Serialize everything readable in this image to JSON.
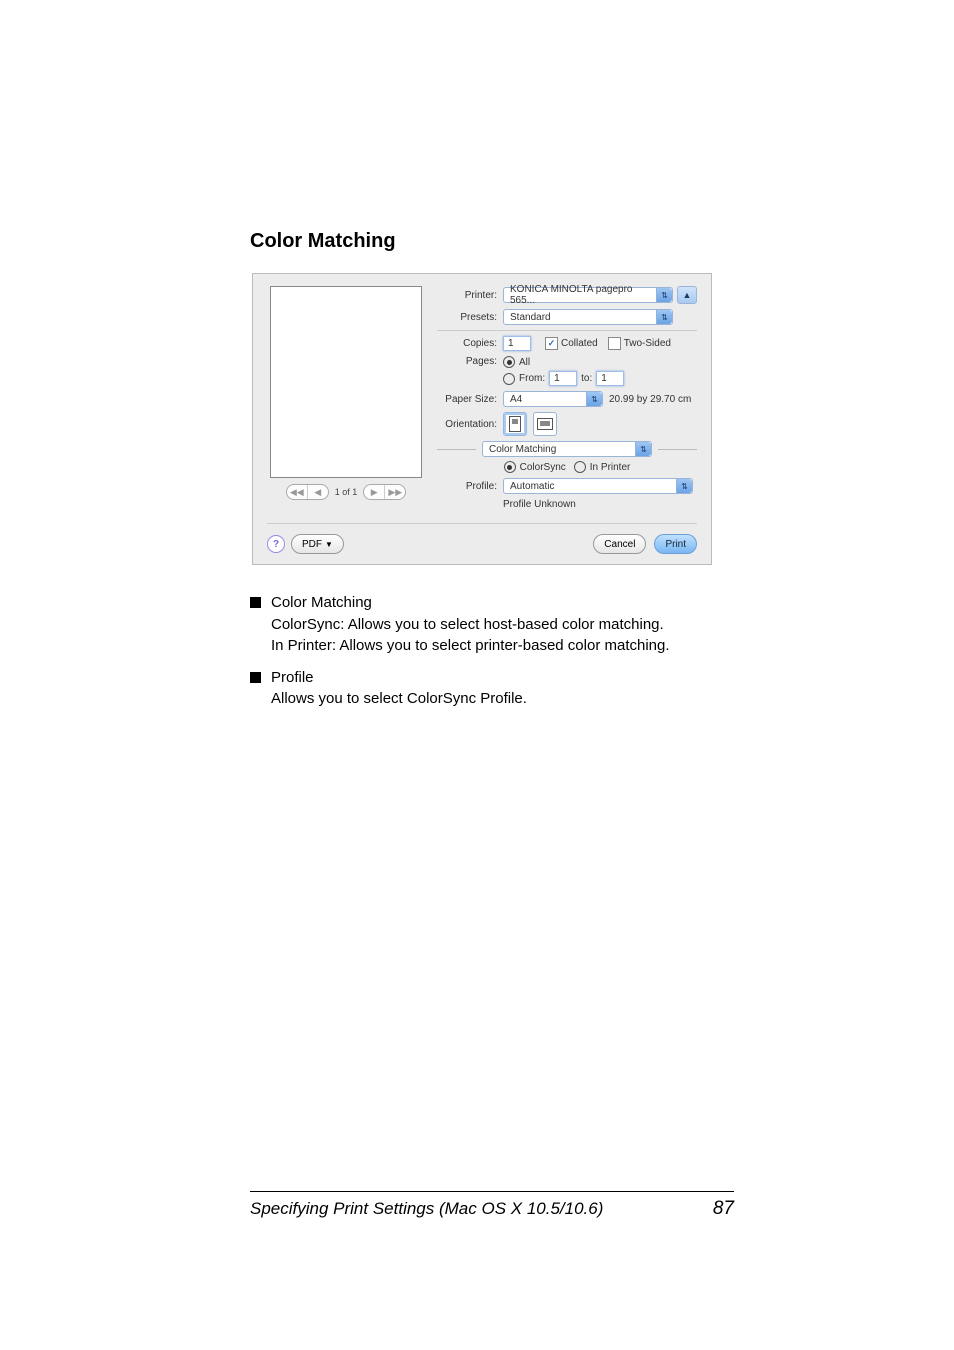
{
  "section_title": "Color Matching",
  "dialog": {
    "printer_label": "Printer:",
    "printer_value": "KONICA MINOLTA pagepro 565...",
    "presets_label": "Presets:",
    "presets_value": "Standard",
    "copies_label": "Copies:",
    "copies_value": "1",
    "collated_label": "Collated",
    "twosided_label": "Two-Sided",
    "pages_label": "Pages:",
    "pages_all": "All",
    "pages_from_label": "From:",
    "pages_from_value": "1",
    "pages_to_label": "to:",
    "pages_to_value": "1",
    "papersize_label": "Paper Size:",
    "papersize_value": "A4",
    "papersize_dim": "20.99 by 29.70 cm",
    "orientation_label": "Orientation:",
    "pane_value": "Color Matching",
    "cm_colorsync": "ColorSync",
    "cm_inprinter": "In Printer",
    "profile_label": "Profile:",
    "profile_value": "Automatic",
    "profile_status": "Profile Unknown",
    "pager_text": "1 of 1",
    "pdf_label": "PDF",
    "cancel_label": "Cancel",
    "print_label": "Print"
  },
  "body": {
    "b1_title": "Color Matching",
    "b1_l1": "ColorSync: Allows you to select host-based color matching.",
    "b1_l2": "In Printer: Allows you to select printer-based color matching.",
    "b2_title": "Profile",
    "b2_l1": "Allows you to select ColorSync Profile."
  },
  "footer": {
    "title": "Specifying Print Settings (Mac OS X 10.5/10.6)",
    "page": "87"
  }
}
